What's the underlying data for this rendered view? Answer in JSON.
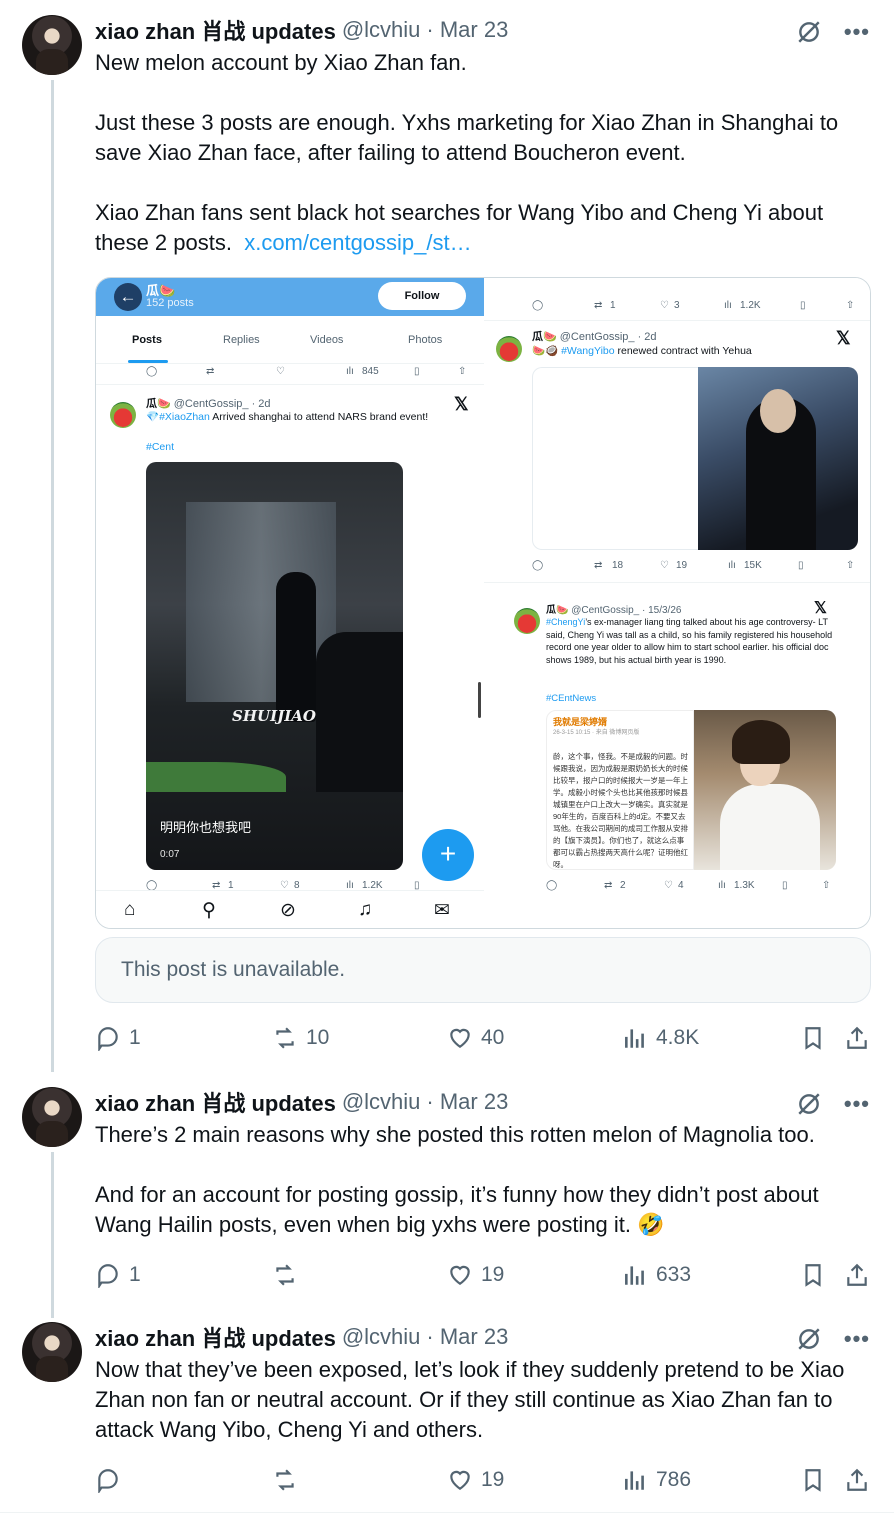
{
  "tweets": [
    {
      "name": "xiao zhan 肖战 updates",
      "handle": "@lcvhiu",
      "date": "· Mar 23",
      "text_parts": [
        "New melon account by Xiao Zhan fan.\n\nJust these 3 posts are enough. Yxhs marketing for Xiao Zhan in Shanghai to save Xiao Zhan face, after failing to attend Boucheron event.\n\nXiao Zhan fans sent black hot searches for Wang Yibo and Cheng Yi about these 2 posts.  "
      ],
      "link": "x.com/centgossip_/st…",
      "quote_unavailable": "This post is unavailable.",
      "replies": "1",
      "reposts": "10",
      "likes": "40",
      "views": "4.8K"
    },
    {
      "name": "xiao zhan 肖战 updates",
      "handle": "@lcvhiu",
      "date": "· Mar 23",
      "text": "There’s 2 main reasons why she posted this rotten melon of Magnolia too.\n\nAnd for an account for posting gossip, it’s funny how they didn’t post about Wang Hailin posts, even when big yxhs were posting it. 🤣",
      "replies": "1",
      "reposts": "",
      "likes": "19",
      "views": "633"
    },
    {
      "name": "xiao zhan 肖战 updates",
      "handle": "@lcvhiu",
      "date": "· Mar 23",
      "text": "Now that they’ve been exposed, let’s look if they suddenly pretend to be Xiao Zhan non fan or neutral account. Or if they still continue as Xiao Zhan fan to attack Wang Yibo, Cheng Yi and others.",
      "replies": "",
      "reposts": "",
      "likes": "19",
      "views": "786"
    }
  ],
  "embedded": {
    "profile_title": "瓜🍉",
    "profile_posts": "152 posts",
    "follow_label": "Follow",
    "tabs": [
      "Posts",
      "Replies",
      "Videos",
      "Photos"
    ],
    "left_top_views": "845",
    "post1": {
      "head_name": "瓜🍉",
      "head_handle": "@CentGossip_ · 2d",
      "tag": "#XiaoZhan",
      "text": " Arrived shanghai to attend NARS brand event!",
      "hashtag": "#Cent",
      "watermark": "SHUIJIAO",
      "caption": "明明你也想我吧",
      "duration": "0:07",
      "reposts": "1",
      "likes": "8",
      "views": "1.2K"
    },
    "right_top": {
      "reposts": "1",
      "likes": "3",
      "views": "1.2K"
    },
    "post2": {
      "head_name": "瓜🍉",
      "head_handle": "@CentGossip_ · 2d",
      "tag": "#WangYibo",
      "text": " renewed contract with Yehua",
      "reposts": "18",
      "likes": "19",
      "views": "15K"
    },
    "post3": {
      "head_name": "瓜🍉",
      "head_handle": "@CentGossip_ · 15/3/26",
      "tag": "#ChengYi",
      "text": "’s ex-manager liang ting talked about his age controversy- LT said, Cheng Yi was tall as a child, so his family registered his household record one year older to allow him to start school earlier. his official doc shows 1989, but his actual birth year is 1990.",
      "hashtag": "#CEntNews",
      "weibo_name": "我就是梁婷婿",
      "weibo_meta": "26-3-15 10:15 · 来自 微博网页版",
      "weibo_text": "龄，这个事，怪我。不是成毅的问题。时候跟我说，因为成毅是跟奶奶长大的时候比较早，报户口的时候报大一岁是一年上学。成毅小时候个头也比其他孩那时候县城镇里在户口上改大一岁确实。真实就是90年生的，百度百科上的d定。不要又去骂他。在我公司期间的成司工作服从安排的【旗下演员】。你们也了，就这么点事都可以霸占热搜两天高什么呢？证明他红呀。",
      "reposts": "2",
      "likes": "4",
      "views": "1.3K"
    }
  },
  "icons": {
    "accent": "#1d9bf0",
    "muted": "#536471",
    "thread_line": "#cfd9de"
  }
}
